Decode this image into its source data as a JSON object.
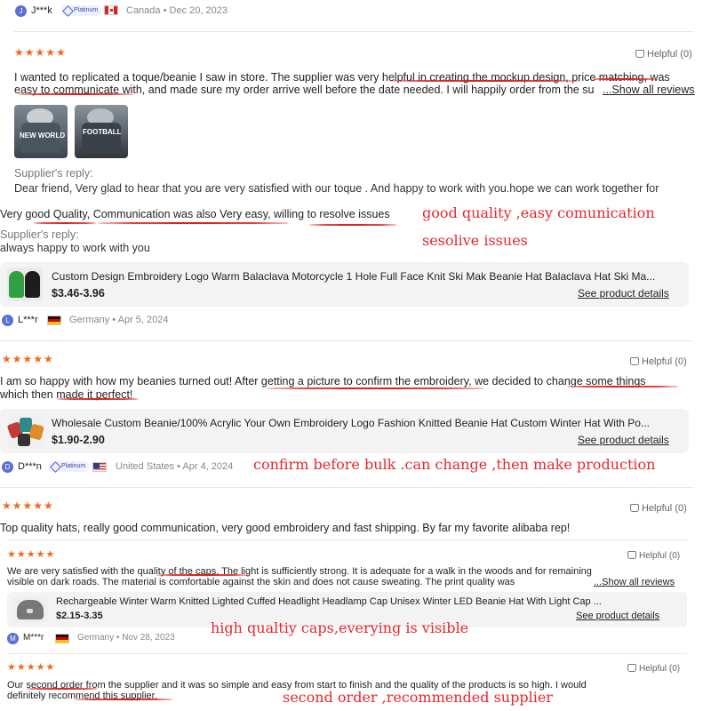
{
  "reviews": [
    {
      "avatar": "J",
      "user": "J***k",
      "badge": "Platinum",
      "country": "Canada",
      "date": "Dec 20, 2023",
      "stars": "★★★★★",
      "helpful": "Helpful (0)",
      "text_line1": "I wanted to replicated a toque/beanie I saw in store. The supplier was very helpful in creating the mockup design, price matching, was",
      "text_line2": "easy to communicate with, and made sure my order arrive well before the date needed. I will happily order from the su",
      "show_all": "...Show all reviews",
      "photo1_label": "NEW WORLD",
      "photo2_label": "FOOTBALL",
      "reply_label": "Supplier's reply:",
      "reply_text": "Dear friend, Very glad to hear that you are very satisfied with our toque . And happy to work with you.hope we can work together for"
    },
    {
      "text": "Very good Quality, Communication was also Very easy, willing to resolve issues",
      "reply_label": "Supplier's reply:",
      "reply_text": "always happy to work with you",
      "product_title": "Custom Design Embroidery Logo Warm Balaclava Motorcycle 1 Hole Full Face Knit Ski Mak Beanie Hat Balaclava Hat Ski Ma...",
      "product_price": "$3.46-3.96",
      "product_link": "See product details",
      "avatar": "L",
      "user": "L***r",
      "country": "Germany",
      "date": "Apr 5, 2024"
    },
    {
      "stars": "★★★★★",
      "helpful": "Helpful (0)",
      "text_line1": "I am so happy with how my beanies turned out! After getting a picture to confirm the embroidery, we decided to change some things",
      "text_line2": "which then made it perfect!",
      "product_title": "Wholesale Custom Beanie/100% Acrylic Your Own Embroidery Logo Fashion Knitted Beanie Hat Custom Winter Hat With Po...",
      "product_price": "$1.90-2.90",
      "product_link": "See product details",
      "avatar": "D",
      "user": "D***n",
      "badge": "Platinum",
      "country": "United States",
      "date": "Apr 4, 2024"
    },
    {
      "stars": "★★★★★",
      "helpful": "Helpful (0)",
      "text": "Top quality hats, really good communication, very good embroidery and fast shipping. By far my favorite alibaba rep!"
    },
    {
      "stars": "★★★★★",
      "helpful": "Helpful (0)",
      "text_line1": "We are very satisfied with the quality of the caps. The light is sufficiently strong. It is adequate for a walk in the woods and for remaining",
      "text_line2": "visible on dark roads. The material is comfortable against the skin and does not cause sweating. The print quality was ",
      "show_all": "...Show all reviews",
      "product_title": "Rechargeable Winter Warm Knitted Lighted Cuffed Headlight Headlamp Cap Unisex Winter LED Beanie Hat With Light Cap ...",
      "product_price": "$2.15-3.35",
      "product_link": "See product details",
      "avatar": "M",
      "user": "M***r",
      "country": "Germany",
      "date": "Nov 28, 2023"
    },
    {
      "stars": "★★★★★",
      "helpful": "Helpful (0)",
      "text_line1": "Our second order from the supplier and it was so simple and easy from start to finish and the quality of the products is so high. I would",
      "text_line2": "definitely recommend this supplier."
    }
  ],
  "annotations": {
    "a1": "good quality ,easy comunication",
    "a2": "sesolive issues",
    "a3": "confirm before bulk .can change ,then make production",
    "a4": "high qualtiy caps,everying is visible",
    "a5": "second order ,recommended supplier"
  },
  "colors": {
    "stars": "#f06a1d",
    "annotation": "#e8262b",
    "avatar": "#5b6fd6"
  }
}
